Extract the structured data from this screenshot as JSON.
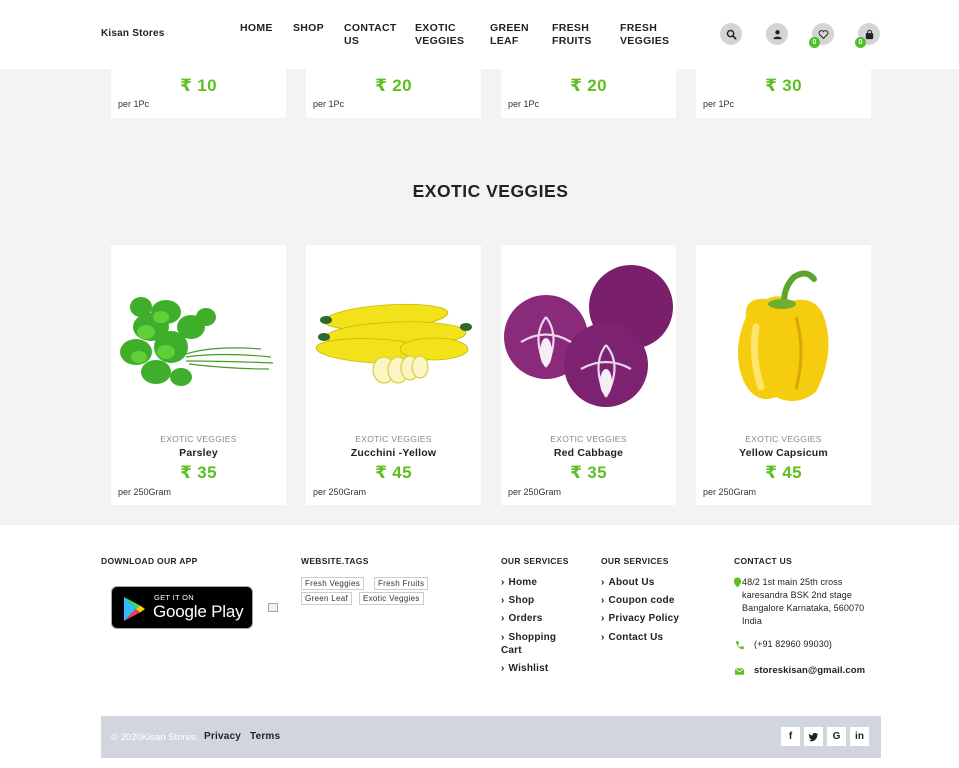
{
  "header": {
    "brand": "Kisan Stores",
    "nav": [
      {
        "line1": "HOME",
        "line2": ""
      },
      {
        "line1": "SHOP",
        "line2": ""
      },
      {
        "line1": "CONTACT",
        "line2": "US"
      },
      {
        "line1": "EXOTIC",
        "line2": "VEGGIES"
      },
      {
        "line1": "GREEN",
        "line2": "LEAF"
      },
      {
        "line1": "FRESH",
        "line2": "FRUITS"
      },
      {
        "line1": "FRESH",
        "line2": "VEGGIES"
      }
    ],
    "wishlist_count": "0",
    "cart_count": "0"
  },
  "top_row": [
    {
      "price": "₹ 10",
      "unit": "per 1Pc"
    },
    {
      "price": "₹ 20",
      "unit": "per 1Pc"
    },
    {
      "price": "₹ 20",
      "unit": "per 1Pc"
    },
    {
      "price": "₹ 30",
      "unit": "per 1Pc"
    }
  ],
  "section": {
    "title": "EXOTIC VEGGIES",
    "products": [
      {
        "category": "EXOTIC VEGGIES",
        "name": "Parsley",
        "price": "₹ 35",
        "unit": "per 250Gram"
      },
      {
        "category": "EXOTIC VEGGIES",
        "name": "Zucchini -Yellow",
        "price": "₹ 45",
        "unit": "per 250Gram"
      },
      {
        "category": "EXOTIC VEGGIES",
        "name": "Red Cabbage",
        "price": "₹ 35",
        "unit": "per 250Gram"
      },
      {
        "category": "EXOTIC VEGGIES",
        "name": "Yellow Capsicum",
        "price": "₹ 45",
        "unit": "per 250Gram"
      }
    ]
  },
  "footer": {
    "download_head": "DOWNLOAD OUR APP",
    "gplay_small": "GET IT ON",
    "gplay_big": "Google Play",
    "tags_head": "WEBSITE.TAGS",
    "tags": [
      "Fresh Veggies",
      "Fresh Fruits",
      "Green Leaf",
      "Exotic Veggies"
    ],
    "services1_head": "OUR SERVICES",
    "services1": [
      "Home",
      "Shop",
      "Orders",
      "Shopping",
      "Cart",
      "Wishlist"
    ],
    "services2_head": "OUR SERVICES",
    "services2": [
      "About Us",
      "Coupon code",
      "Privacy Policy",
      "Contact Us"
    ],
    "contact_head": "CONTACT US",
    "address": [
      "48/2 1st main 25th cross",
      "karesandra BSK 2nd stage",
      "Bangalore Karnataka, 560070",
      "India"
    ],
    "phone": "(+91 82960 99030)",
    "email": "storeskisan@gmail.com",
    "copyright": "© 2020Kisan Stores.",
    "privacy": "Privacy",
    "terms": "Terms",
    "social": [
      "f",
      "t",
      "G",
      "in"
    ]
  },
  "colors": {
    "accent": "#5cbf1f",
    "bottom_bar": "#d1d5de",
    "page_bg": "#f3f3f3"
  }
}
